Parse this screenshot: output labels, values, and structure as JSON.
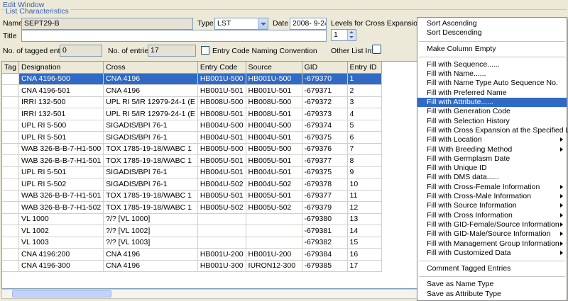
{
  "window": {
    "title": "Edit Window",
    "group_legend": "List Characteristics"
  },
  "form": {
    "name_label": "Name",
    "name_value": "SEPT29-B",
    "type_label": "Type",
    "type_value": "LST",
    "date_label": "Date",
    "date_value": "2008- 9-24",
    "levels_label": "Levels for Cross Expansion",
    "levels_value": "1",
    "title_label": "Title",
    "title_value": "",
    "tagged_label": "No. of tagged entries",
    "tagged_value": "0",
    "entries_label": "No. of entries",
    "entries_value": "17",
    "naming_label": "Entry Code Naming Convention",
    "other_label": "Other List Info"
  },
  "table": {
    "columns": [
      "Tag",
      "Designation",
      "Cross",
      "Entry Code",
      "Source",
      "GID",
      "Entry ID"
    ],
    "selected_row": 0,
    "rows": [
      [
        "",
        "CNA 4196-500",
        "CNA 4196",
        "HB001U-500",
        "HB001U-500",
        "-679370",
        "1"
      ],
      [
        "",
        "CNA 4196-501",
        "CNA 4196",
        "HB001U-501",
        "HB001U-501",
        "-679371",
        "2"
      ],
      [
        "",
        "IRRI 132-500",
        "UPL RI 5/IR 12979-24-1 (E",
        "HB008U-500",
        "HB008U-500",
        "-679372",
        "3"
      ],
      [
        "",
        "IRRI 132-501",
        "UPL RI 5/IR 12979-24-1 (E",
        "HB008U-501",
        "HB008U-501",
        "-679373",
        "4"
      ],
      [
        "",
        "UPL RI 5-500",
        "SIGADIS/BPI 76-1",
        "HB004U-500",
        "HB004U-500",
        "-679374",
        "5"
      ],
      [
        "",
        "UPL RI 5-501",
        "SIGADIS/BPI 76-1",
        "HB004U-501",
        "HB004U-501",
        "-679375",
        "6"
      ],
      [
        "",
        "WAB 326-B-B-7-H1-500",
        "TOX 1785-19-18/WABC 1",
        "HB005U-500",
        "HB005U-500",
        "-679376",
        "7"
      ],
      [
        "",
        "WAB 326-B-B-7-H1-501",
        "TOX 1785-19-18/WABC 1",
        "HB005U-501",
        "HB005U-501",
        "-679377",
        "8"
      ],
      [
        "",
        "UPL RI 5-501",
        "SIGADIS/BPI 76-1",
        "HB004U-501",
        "HB004U-501",
        "-679375",
        "9"
      ],
      [
        "",
        "UPL RI 5-502",
        "SIGADIS/BPI 76-1",
        "HB004U-502",
        "HB004U-502",
        "-679378",
        "10"
      ],
      [
        "",
        "WAB 326-B-B-7-H1-501",
        "TOX 1785-19-18/WABC 1",
        "HB005U-501",
        "HB005U-501",
        "-679377",
        "11"
      ],
      [
        "",
        "WAB 326-B-B-7-H1-502",
        "TOX 1785-19-18/WABC 1",
        "HB005U-502",
        "HB005U-502",
        "-679379",
        "12"
      ],
      [
        "",
        "VL 1000",
        "?/? [VL 1000]",
        "",
        "",
        "-679380",
        "13"
      ],
      [
        "",
        "VL 1002",
        "?/? [VL 1002]",
        "",
        "",
        "-679381",
        "14"
      ],
      [
        "",
        "VL 1003",
        "?/? [VL 1003]",
        "",
        "",
        "-679382",
        "15"
      ],
      [
        "",
        "CNA 4196:200",
        "CNA 4196",
        "HB001U-200",
        "HB001U-200",
        "-679384",
        "16"
      ],
      [
        "",
        "CNA 4196-300",
        "CNA 4196",
        "HB001U-300",
        "IURON12-300",
        "-679385",
        "17"
      ]
    ]
  },
  "context_menu": {
    "items": [
      {
        "label": "Sort Ascending",
        "submenu": false,
        "highlighted": false
      },
      {
        "label": "Sort Descending",
        "submenu": false,
        "highlighted": false
      },
      {
        "sep": true
      },
      {
        "label": "Make Column Empty",
        "submenu": false,
        "highlighted": false
      },
      {
        "sep": true
      },
      {
        "label": "Fill with Sequence......",
        "submenu": false,
        "highlighted": false
      },
      {
        "label": "Fill with Name......",
        "submenu": false,
        "highlighted": false
      },
      {
        "label": "Fill with Name Type Auto Sequence No.",
        "submenu": false,
        "highlighted": false
      },
      {
        "label": "Fill with Preferred Name",
        "submenu": false,
        "highlighted": false
      },
      {
        "label": "Fill with Attribute......",
        "submenu": false,
        "highlighted": true
      },
      {
        "label": "Fill with Generation Code",
        "submenu": false,
        "highlighted": false
      },
      {
        "label": "Fill with Selection History",
        "submenu": false,
        "highlighted": false
      },
      {
        "label": "Fill with Cross Expansion at the Specified Level",
        "submenu": false,
        "highlighted": false
      },
      {
        "label": "Fill with Location",
        "submenu": true,
        "highlighted": false
      },
      {
        "label": "Fill With Breeding Method",
        "submenu": true,
        "highlighted": false
      },
      {
        "label": "Fill with Germplasm Date",
        "submenu": false,
        "highlighted": false
      },
      {
        "label": "Fill with Unique ID",
        "submenu": false,
        "highlighted": false
      },
      {
        "label": "Fill with DMS data......",
        "submenu": false,
        "highlighted": false
      },
      {
        "label": "Fill with Cross-Female Information",
        "submenu": true,
        "highlighted": false
      },
      {
        "label": "Fill with Cross-Male Information",
        "submenu": true,
        "highlighted": false
      },
      {
        "label": "Fill with Source Information",
        "submenu": true,
        "highlighted": false
      },
      {
        "label": "Fill with Cross Information",
        "submenu": true,
        "highlighted": false
      },
      {
        "label": "Fill with GID-Female/Source Information",
        "submenu": true,
        "highlighted": false
      },
      {
        "label": "Fill with GID-Male/Source Information",
        "submenu": true,
        "highlighted": false
      },
      {
        "label": "Fill with Management Group Information",
        "submenu": true,
        "highlighted": false
      },
      {
        "label": "Fill with Customized Data",
        "submenu": true,
        "highlighted": false
      },
      {
        "sep": true
      },
      {
        "label": "Comment Tagged Entries",
        "submenu": false,
        "highlighted": false
      },
      {
        "sep": true
      },
      {
        "label": "Save as Name Type",
        "submenu": false,
        "highlighted": false
      },
      {
        "label": "Save as Attribute Type",
        "submenu": false,
        "highlighted": false
      }
    ]
  },
  "colors": {
    "selection": "#316ac5",
    "window_bg": "#ece9d8",
    "accent_text": "#3c5fa8"
  }
}
